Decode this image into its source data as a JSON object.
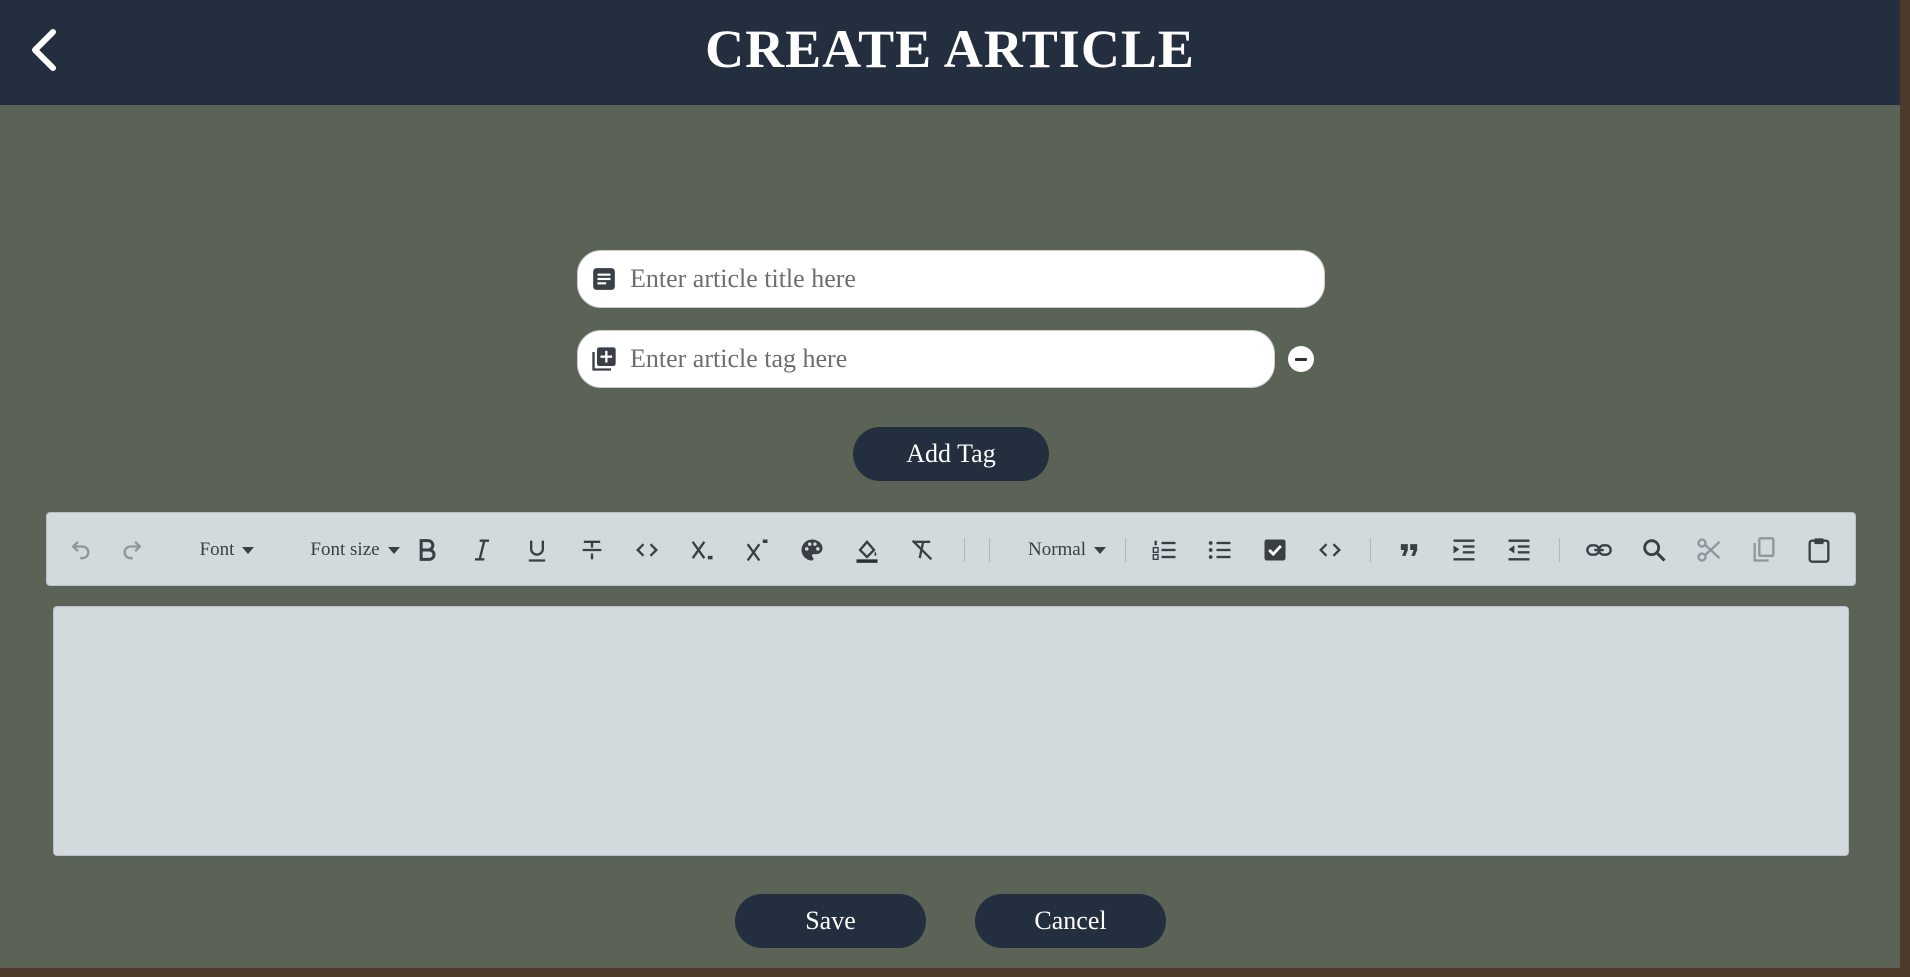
{
  "header": {
    "title": "CREATE ARTICLE"
  },
  "form": {
    "title_placeholder": "Enter article title here",
    "tag_placeholder": "Enter article tag here",
    "add_tag_label": "Add Tag"
  },
  "toolbar": {
    "font_label": "Font",
    "font_size_label": "Font size",
    "block_format_label": "Normal"
  },
  "actions": {
    "save_label": "Save",
    "cancel_label": "Cancel"
  },
  "colors": {
    "header_bg": "#232e3e",
    "page_bg": "#5b6356",
    "button_bg": "#232e3e",
    "toolbar_bg": "#d3dadd",
    "icon": "#3a3f46",
    "icon_disabled": "#8f969c"
  }
}
